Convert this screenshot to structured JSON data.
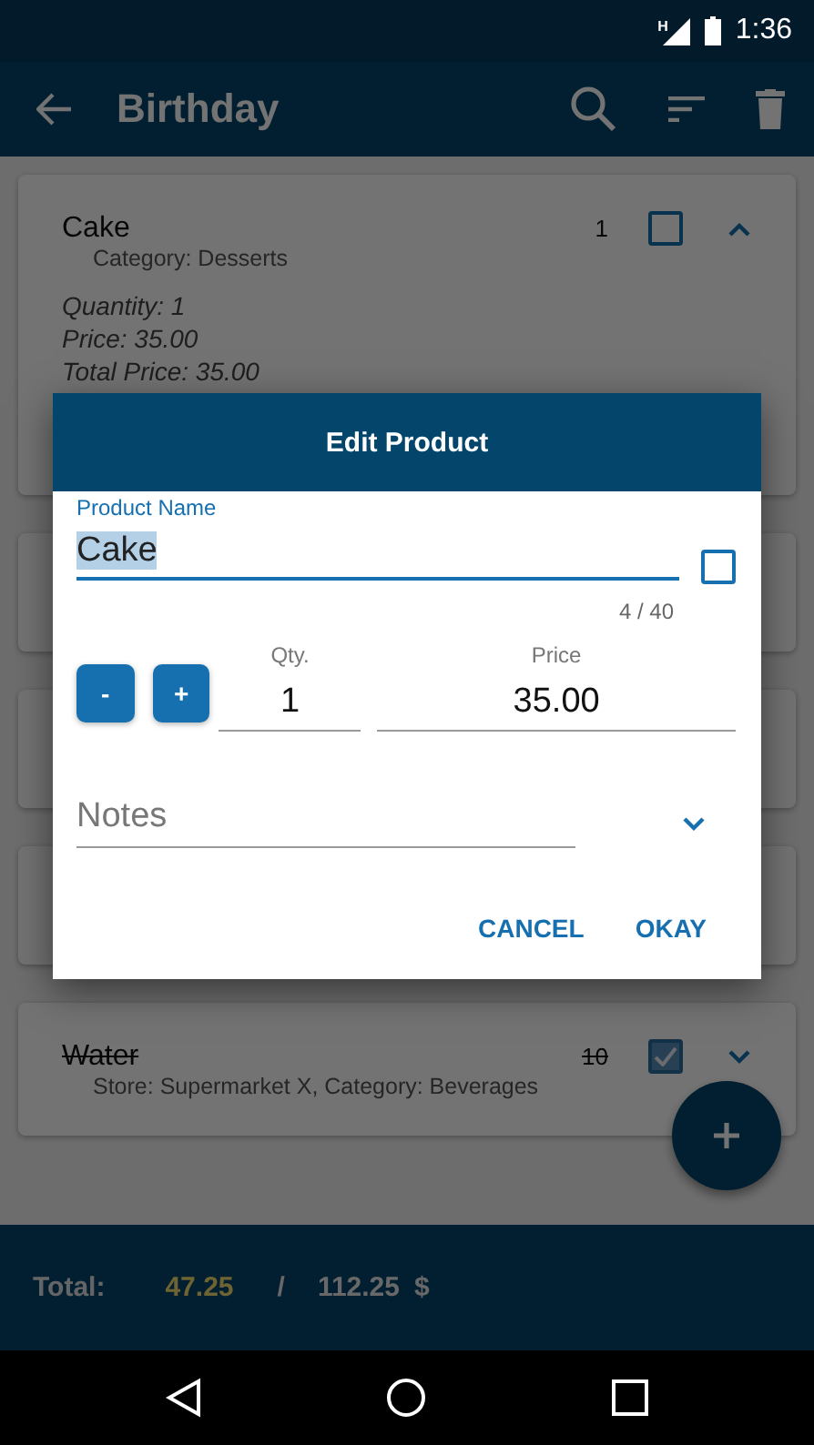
{
  "status_bar": {
    "network": "H",
    "time": "1:36"
  },
  "app_bar": {
    "title": "Birthday"
  },
  "products": [
    {
      "kind": "product",
      "name": "Cake",
      "quantity": "1",
      "subtitle": "Category: Desserts",
      "checked": false,
      "expanded": true,
      "details": [
        "Quantity: 1",
        "Price: 35.00",
        "Total Price: 35.00"
      ]
    },
    {
      "kind": "covered"
    },
    {
      "kind": "covered"
    },
    {
      "kind": "covered"
    },
    {
      "kind": "product",
      "name": "Water",
      "quantity": "10",
      "subtitle": "Store: Supermarket X, Category: Beverages",
      "checked": true,
      "expanded": false
    }
  ],
  "totals": {
    "label": "Total:",
    "checked_total": "47.25",
    "separator": "/",
    "grand_total": "112.25",
    "currency": "$"
  },
  "dialog": {
    "title": "Edit Product",
    "name_field": {
      "label": "Product Name",
      "value": "Cake",
      "value_selected": true,
      "counter": "4 / 40"
    },
    "checked": false,
    "decrement": "-",
    "increment": "+",
    "quantity": {
      "label": "Qty.",
      "value": "1"
    },
    "price": {
      "label": "Price",
      "value": "35.00"
    },
    "notes": {
      "placeholder": "Notes",
      "expanded": false
    },
    "buttons": [
      "CANCEL",
      "OKAY"
    ]
  }
}
